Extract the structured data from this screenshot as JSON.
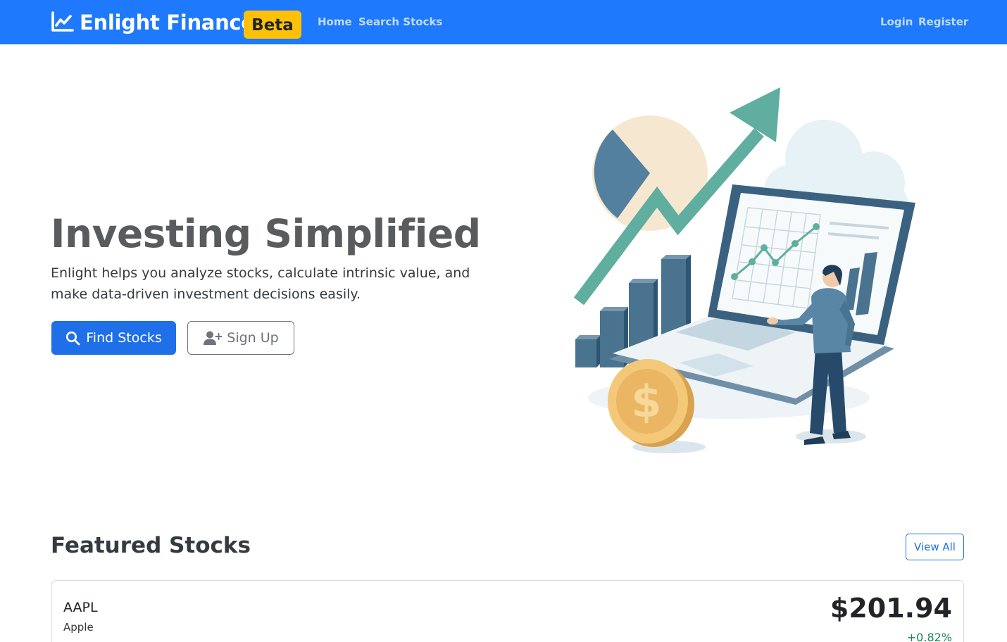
{
  "navbar": {
    "brand": "Enlight Finance",
    "badge": "Beta",
    "links": [
      "Home",
      "Search Stocks"
    ],
    "auth": [
      "Login",
      "Register"
    ],
    "background": "#1e79fc"
  },
  "hero": {
    "title": "Investing Simplified",
    "lead": "Enlight helps you analyze stocks, calculate intrinsic value, and make data-driven investment decisions easily.",
    "primary_button": "Find Stocks",
    "secondary_button": "Sign Up"
  },
  "featured": {
    "title": "Featured Stocks",
    "view_all": "View All",
    "stocks": [
      {
        "ticker": "AAPL",
        "name": "Apple",
        "price": "$201.94",
        "change": "+0.82%"
      }
    ]
  },
  "colors": {
    "primary": "#1e6fe8",
    "badge": "#ffc107",
    "positive": "#198754",
    "accent_teal": "#5fae9f",
    "accent_slate": "#4a7390"
  },
  "icons": {
    "brand": "chart-line-icon",
    "primary_button": "search-icon",
    "secondary_button": "user-plus-icon"
  }
}
